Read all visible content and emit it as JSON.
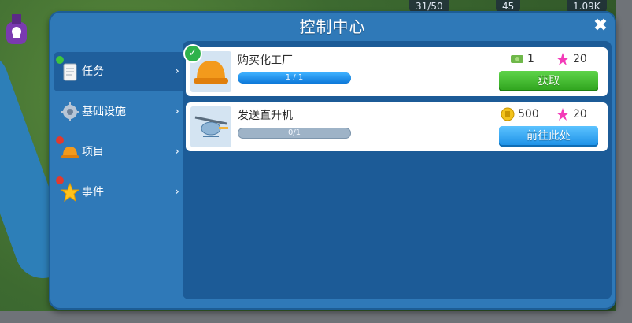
{
  "title": "控制中心",
  "topbar": {
    "population": "31/50",
    "level": "45",
    "cash": "1.09K"
  },
  "sidebar": {
    "items": [
      {
        "label": "任务",
        "active": true,
        "dot_color": "#3ec43e"
      },
      {
        "label": "基础设施",
        "active": false,
        "dot_color": ""
      },
      {
        "label": "项目",
        "active": false,
        "dot_color": "#e03a2f"
      },
      {
        "label": "事件",
        "active": false,
        "dot_color": "#e03a2f"
      }
    ]
  },
  "tasks": [
    {
      "name": "购买化工厂",
      "progress_text": "1 / 1",
      "progress": 1.0,
      "completed": true,
      "reward_1": {
        "icon": "cash-icon",
        "value": "1"
      },
      "reward_2": {
        "icon": "star-icon",
        "value": "20"
      },
      "button_label": "获取",
      "button_color": "#2da21c"
    },
    {
      "name": "发送直升机",
      "progress_text": "0/1",
      "progress": 0.0,
      "completed": false,
      "reward_1": {
        "icon": "coin-icon",
        "value": "500"
      },
      "reward_2": {
        "icon": "star-icon",
        "value": "20"
      },
      "button_label": "前往此处",
      "button_color": "#1a8fe6"
    }
  ]
}
